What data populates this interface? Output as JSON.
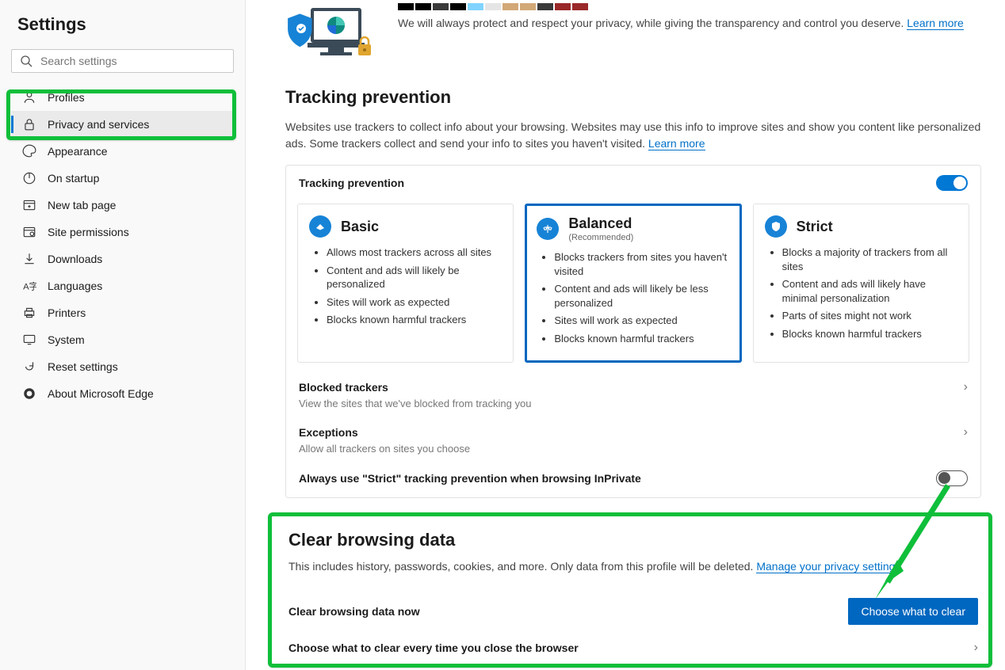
{
  "sidebar": {
    "title": "Settings",
    "search_placeholder": "Search settings",
    "items": [
      {
        "label": "Profiles"
      },
      {
        "label": "Privacy and services"
      },
      {
        "label": "Appearance"
      },
      {
        "label": "On startup"
      },
      {
        "label": "New tab page"
      },
      {
        "label": "Site permissions"
      },
      {
        "label": "Downloads"
      },
      {
        "label": "Languages"
      },
      {
        "label": "Printers"
      },
      {
        "label": "System"
      },
      {
        "label": "Reset settings"
      },
      {
        "label": "About Microsoft Edge"
      }
    ]
  },
  "hero": {
    "swatch_colors": [
      "#000",
      "#000",
      "#3a3a3a",
      "#000",
      "#80d4ff",
      "#e5e5e5",
      "#d2a876",
      "#d2a876",
      "#3a3a3a",
      "#9a2929",
      "#9a2929"
    ],
    "text": "We will always protect and respect your privacy, while giving the transparency and control you deserve. ",
    "link": "Learn more"
  },
  "tracking": {
    "title": "Tracking prevention",
    "desc_prefix": "Websites use trackers to collect info about your browsing. Websites may use this info to improve sites and show you content like personalized ads. Some trackers collect and send your info to sites you haven't visited. ",
    "desc_link": "Learn more",
    "card_header": "Tracking prevention",
    "levels": [
      {
        "name": "Basic",
        "sub": "",
        "bullets": [
          "Allows most trackers across all sites",
          "Content and ads will likely be personalized",
          "Sites will work as expected",
          "Blocks known harmful trackers"
        ]
      },
      {
        "name": "Balanced",
        "sub": "(Recommended)",
        "bullets": [
          "Blocks trackers from sites you haven't visited",
          "Content and ads will likely be less personalized",
          "Sites will work as expected",
          "Blocks known harmful trackers"
        ]
      },
      {
        "name": "Strict",
        "sub": "",
        "bullets": [
          "Blocks a majority of trackers from all sites",
          "Content and ads will likely have minimal personalization",
          "Parts of sites might not work",
          "Blocks known harmful trackers"
        ]
      }
    ],
    "blocked_title": "Blocked trackers",
    "blocked_sub": "View the sites that we've blocked from tracking you",
    "exceptions_title": "Exceptions",
    "exceptions_sub": "Allow all trackers on sites you choose",
    "strict_inprivate": "Always use \"Strict\" tracking prevention when browsing InPrivate"
  },
  "cbd": {
    "title": "Clear browsing data",
    "desc_prefix": "This includes history, passwords, cookies, and more. Only data from this profile will be deleted. ",
    "desc_link": "Manage your privacy settings",
    "now_title": "Clear browsing data now",
    "now_button": "Choose what to clear",
    "onclose_title": "Choose what to clear every time you close the browser"
  }
}
